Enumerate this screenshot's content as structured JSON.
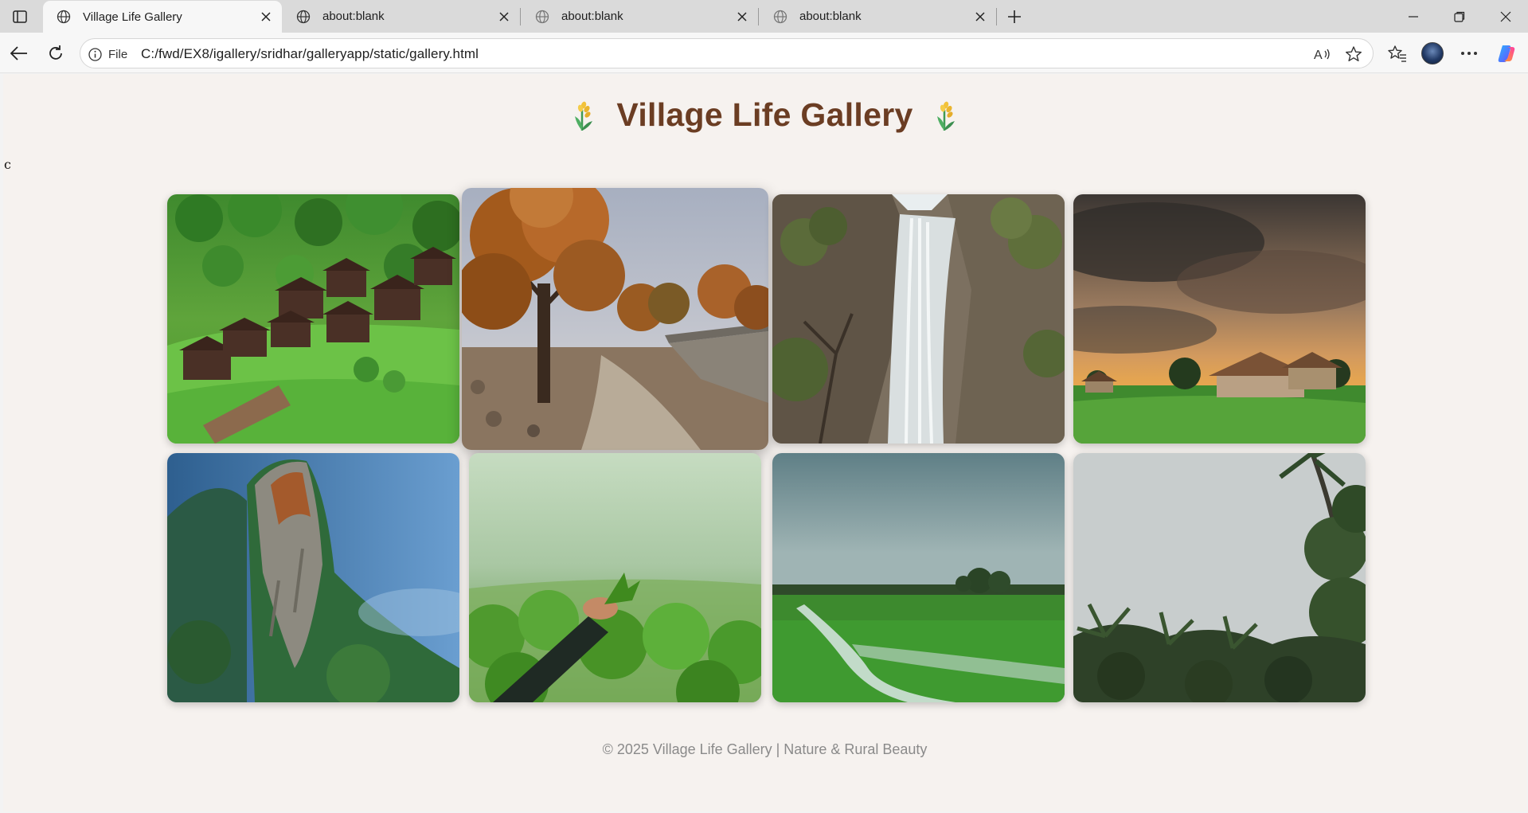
{
  "browser": {
    "tabs": [
      {
        "title": "Village Life Gallery",
        "active": true
      },
      {
        "title": "about:blank",
        "active": false
      },
      {
        "title": "about:blank",
        "active": false
      },
      {
        "title": "about:blank",
        "active": false
      }
    ],
    "address": {
      "security_label": "File",
      "url": "C:/fwd/EX8/igallery/sridhar/galleryapp/static/gallery.html"
    }
  },
  "page": {
    "stray_text": "c",
    "title": "Village Life Gallery",
    "title_color": "#6b3d23",
    "background": "#f6f2ef",
    "gallery": {
      "hovered_index": 1,
      "images": [
        {
          "scene": "hillside village with wooden huts"
        },
        {
          "scene": "autumn tree beside dirt road"
        },
        {
          "scene": "waterfall over rock cliff"
        },
        {
          "scene": "thatched hut under stormy sunset sky"
        },
        {
          "scene": "misty mountain rock face"
        },
        {
          "scene": "hand holding tea leaf in misty plantation"
        },
        {
          "scene": "flooded green paddy field"
        },
        {
          "scene": "coconut palms under grey sky"
        }
      ]
    },
    "footer": "© 2025 Village Life Gallery | Nature & Rural Beauty"
  }
}
